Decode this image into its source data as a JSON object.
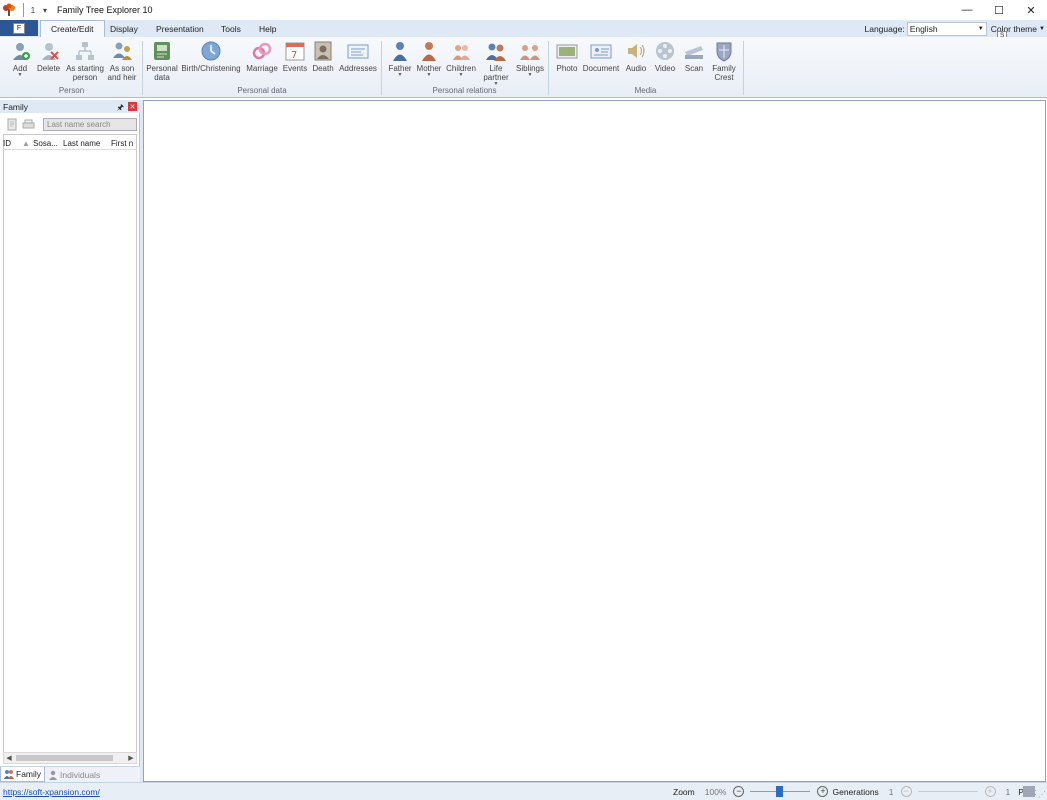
{
  "titlebar": {
    "title": "Family Tree Explorer 10",
    "quick_access_key": "1",
    "controls": [
      "minimize-icon",
      "maximize-icon",
      "close-icon"
    ]
  },
  "ribbon_tabs": {
    "file_key": "F",
    "tabs": [
      "Create/Edit",
      "Display",
      "Presentation",
      "Tools",
      "Help"
    ],
    "active": "Create/Edit",
    "language_label": "Language:",
    "language_value": "English",
    "color_theme": "Color theme",
    "color_theme_key": "S"
  },
  "ribbon": {
    "groups": [
      {
        "label": "Person",
        "buttons": [
          {
            "label": "Add",
            "icon": "add-person-icon",
            "dropdown": true
          },
          {
            "label": "Delete",
            "icon": "delete-person-icon"
          },
          {
            "label": "As starting person",
            "icon": "starting-person-icon"
          },
          {
            "label": "As son and heir",
            "icon": "son-and-heir-icon"
          }
        ]
      },
      {
        "label": "Personal data",
        "buttons": [
          {
            "label": "Personal data",
            "icon": "personal-data-icon"
          },
          {
            "label": "Birth/Christening",
            "icon": "birth-clock-icon"
          },
          {
            "label": "Marriage",
            "icon": "marriage-rings-icon"
          },
          {
            "label": "Events",
            "icon": "calendar-icon"
          },
          {
            "label": "Death",
            "icon": "death-frame-icon"
          },
          {
            "label": "Addresses",
            "icon": "address-card-icon"
          }
        ]
      },
      {
        "label": "Personal relations",
        "buttons": [
          {
            "label": "Father",
            "icon": "father-icon",
            "dropdown": true
          },
          {
            "label": "Mother",
            "icon": "mother-icon",
            "dropdown": true
          },
          {
            "label": "Children",
            "icon": "children-icon",
            "dropdown": true
          },
          {
            "label": "Life partner",
            "icon": "life-partner-icon",
            "dropdown": true
          },
          {
            "label": "Siblings",
            "icon": "siblings-icon",
            "dropdown": true
          }
        ]
      },
      {
        "label": "Media",
        "buttons": [
          {
            "label": "Photo",
            "icon": "photo-icon"
          },
          {
            "label": "Document",
            "icon": "document-icon"
          },
          {
            "label": "Audio",
            "icon": "audio-speaker-icon"
          },
          {
            "label": "Video",
            "icon": "video-reel-icon"
          },
          {
            "label": "Scan",
            "icon": "scanner-icon"
          },
          {
            "label": "Family Crest",
            "icon": "family-crest-icon"
          }
        ]
      }
    ]
  },
  "family_panel": {
    "title": "Family",
    "search_placeholder": "Last name search",
    "columns": [
      "ID",
      "Sosa...",
      "Last name",
      "First n"
    ],
    "tabs": [
      "Family",
      "Individuals"
    ],
    "active_tab": "Family"
  },
  "statusbar": {
    "link": "https://soft-xpansion.com/",
    "zoom_label": "Zoom",
    "zoom_value": "100%",
    "generations_label": "Generations",
    "generations_value": "1",
    "generations_value_right": "1",
    "print_label": "Print"
  },
  "colors": {
    "accent": "#2b5797",
    "ribbon_bg": "#e8eef6",
    "tab_bg": "#dfe9f5"
  }
}
